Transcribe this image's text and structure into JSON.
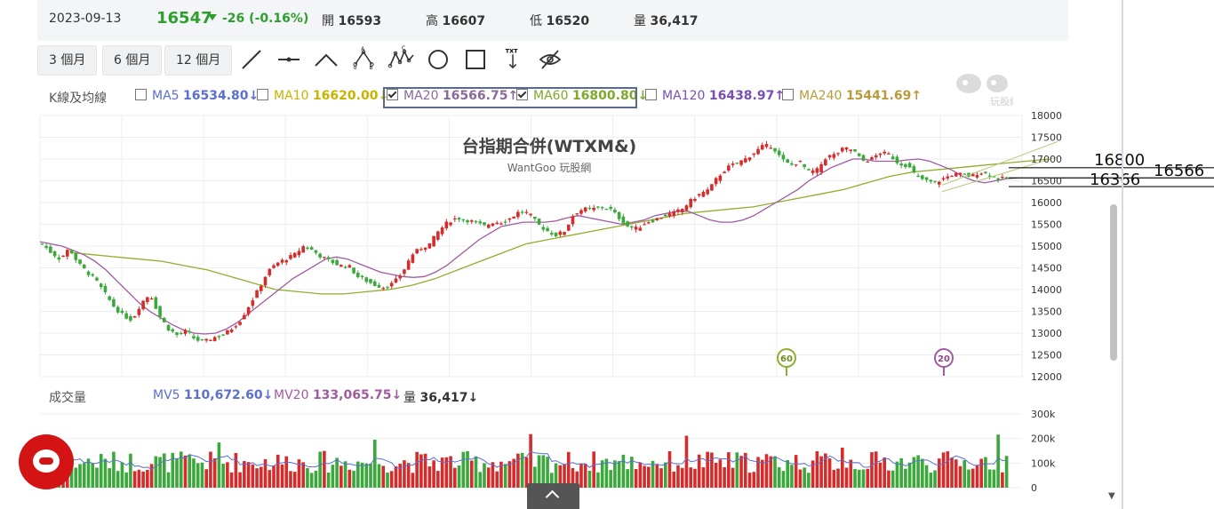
{
  "quote": {
    "date": "2023-09-13",
    "price": "16547",
    "change": "-26 (-0.16%)",
    "open_label": "開",
    "open": "16593",
    "high_label": "高",
    "high": "16607",
    "low_label": "低",
    "low": "16520",
    "volume_label": "量",
    "volume": "36,417"
  },
  "periods": [
    "3 個月",
    "6 個月",
    "12 個月"
  ],
  "tools": [
    "line-tool-icon",
    "hline-tool-icon",
    "ray-tool-icon",
    "abc-tool-icon",
    "wave-tool-icon",
    "circle-tool-icon",
    "rect-tool-icon",
    "text-tool-icon",
    "hide-eye-icon"
  ],
  "ma_legend": {
    "title": "K線及均線",
    "items": [
      {
        "name": "MA5",
        "value": "16534.80↓",
        "checked": false,
        "color": "#5b6fcf"
      },
      {
        "name": "MA10",
        "value": "16620.00↓",
        "checked": false,
        "color": "#d4c21a"
      },
      {
        "name": "MA20",
        "value": "16566.75↑",
        "checked": true,
        "color": "#a05aa0"
      },
      {
        "name": "MA60",
        "value": "16800.80↓",
        "checked": true,
        "color": "#7fa82c"
      },
      {
        "name": "MA120",
        "value": "16438.97↑",
        "checked": false,
        "color": "#7a4fb5"
      },
      {
        "name": "MA240",
        "value": "15441.69↑",
        "checked": false,
        "color": "#b89a3c"
      }
    ]
  },
  "watermark": {
    "title": "台指期合併(WTXM&)",
    "subtitle": "WantGoo 玩股網",
    "logo_text": "玩股網"
  },
  "price_axis_labels": [
    "18000",
    "17500",
    "17000",
    "16500",
    "16000",
    "15500",
    "15000",
    "14500",
    "14000",
    "13500",
    "13000",
    "12500",
    "12000"
  ],
  "annotations": {
    "line1": "16800",
    "line2": "16566",
    "line3": "16366",
    "marker_ma60": "60",
    "marker_ma20": "20"
  },
  "volume_panel": {
    "title": "成交量",
    "mv5_label": "MV5",
    "mv5": "110,672.60↓",
    "mv20_label": "MV20",
    "mv20": "133,065.75↓",
    "vol_label": "量",
    "vol": "36,417↓",
    "axis_labels": [
      "300k",
      "200k",
      "100k",
      "0"
    ]
  },
  "colors": {
    "up": "#d62b2b",
    "down": "#3aa83a",
    "ma20": "#a05aa0",
    "ma60": "#8fae2c",
    "grid": "#eceef2"
  },
  "chart_data": {
    "type": "candlestick",
    "title": "台指期合併(WTXM&)",
    "ylim": [
      12000,
      18000
    ],
    "grid": true,
    "series_ohlc_anchor_closes": [
      15050,
      14850,
      14700,
      14950,
      14600,
      14400,
      14200,
      13900,
      13600,
      13400,
      13300,
      13700,
      13900,
      13400,
      13100,
      12950,
      13050,
      12850,
      12800,
      12900,
      12950,
      13100,
      13300,
      13650,
      14000,
      14400,
      14600,
      14700,
      14800,
      15000,
      14900,
      14750,
      14650,
      14550,
      14550,
      14300,
      14200,
      14100,
      14050,
      14150,
      14400,
      14800,
      14950,
      15050,
      15350,
      15550,
      15650,
      15600,
      15550,
      15450,
      15550,
      15550,
      15650,
      15800,
      15750,
      15500,
      15350,
      15250,
      15350,
      15750,
      15850,
      15850,
      15900,
      15850,
      15650,
      15450,
      15400,
      15550,
      15600,
      15700,
      15750,
      15850,
      16050,
      16200,
      16300,
      16600,
      16800,
      16900,
      17000,
      17150,
      17300,
      17300,
      17000,
      16850,
      16950,
      16700,
      16750,
      17050,
      17100,
      17250,
      17200,
      16950,
      17000,
      17150,
      17100,
      16900,
      16850,
      16600,
      16500,
      16450,
      16550,
      16650,
      16650,
      16600,
      16700,
      16650,
      16550,
      16547
    ],
    "ma20": [
      15100,
      15050,
      15000,
      14900,
      14800,
      14650,
      14450,
      14200,
      13950,
      13700,
      13500,
      13350,
      13200,
      13080,
      13000,
      12980,
      13000,
      13100,
      13250,
      13450,
      13650,
      13850,
      14050,
      14250,
      14400,
      14550,
      14700,
      14750,
      14700,
      14600,
      14500,
      14400,
      14350,
      14300,
      14280,
      14300,
      14400,
      14550,
      14750,
      14950,
      15150,
      15300,
      15450,
      15500,
      15550,
      15550,
      15550,
      15580,
      15650,
      15700,
      15650,
      15600,
      15550,
      15500,
      15550,
      15600,
      15700,
      15750,
      15800,
      15800,
      15700,
      15600,
      15550,
      15550,
      15600,
      15700,
      15850,
      16000,
      16150,
      16300,
      16500,
      16650,
      16800,
      16900,
      17000,
      17000,
      16950,
      16950,
      16950,
      16980,
      17000,
      16950,
      16850,
      16750,
      16600,
      16500,
      16450,
      16500,
      16550,
      16566
    ],
    "ma60": [
      14850,
      14800,
      14750,
      14700,
      14650,
      14550,
      14450,
      14300,
      14150,
      14000,
      13950,
      13900,
      13900,
      13950,
      14000,
      14100,
      14250,
      14450,
      14650,
      14850,
      15050,
      15150,
      15250,
      15350,
      15450,
      15550,
      15650,
      15750,
      15800,
      15850,
      15900,
      16000,
      16100,
      16200,
      16300,
      16450,
      16600,
      16700,
      16750,
      16800,
      16850,
      16900,
      16950,
      17000
    ],
    "annotation_line_ma20": [
      16250,
      17050
    ],
    "annotation_line_ma60": [
      16400,
      17400
    ]
  }
}
